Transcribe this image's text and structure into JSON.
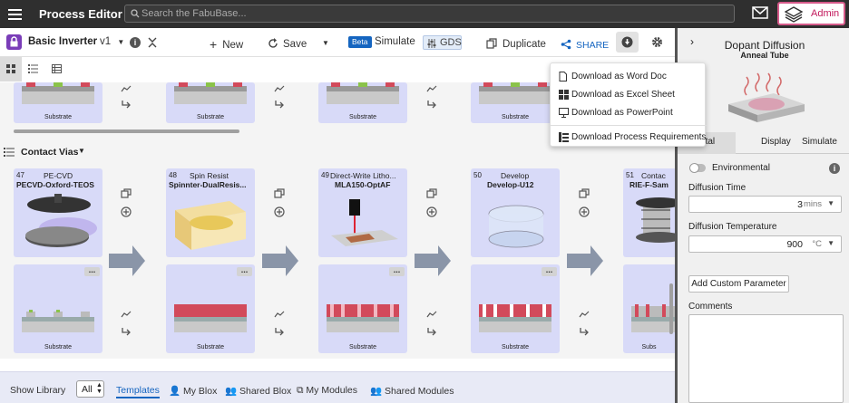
{
  "app": {
    "title": "Process Editor",
    "search_placeholder": "Search the FabuBase...",
    "admin_label": "Admin"
  },
  "toolbar": {
    "process_name": "Basic Inverter",
    "version": "v1",
    "new_label": "New",
    "save_label": "Save",
    "beta_badge": "Beta",
    "simulate_label": "Simulate",
    "gds_label": "GDS",
    "duplicate_label": "Duplicate",
    "share_label": "SHARE"
  },
  "download_menu": {
    "items": [
      "Download as Word Doc",
      "Download as Excel Sheet",
      "Download as PowerPoint",
      "Download Process Requirements"
    ]
  },
  "top_row": {
    "substrate_label": "Substrate"
  },
  "section": {
    "title": "Contact Vias"
  },
  "steps": [
    {
      "num": "47",
      "type": "PE-CVD",
      "name": "PECVD-Oxford-TEOS"
    },
    {
      "num": "48",
      "type": "Spin Resist",
      "name": "Spinnter-DualResis..."
    },
    {
      "num": "49",
      "type": "Direct-Write Litho...",
      "name": "MLA150-OptAF"
    },
    {
      "num": "50",
      "type": "Develop",
      "name": "Develop-U12"
    },
    {
      "num": "51",
      "type": "Contac",
      "name": "RIE-F-Sam"
    }
  ],
  "bottom_row": {
    "substrate_label": "Substrate",
    "partial_label": "Subs"
  },
  "bottombar": {
    "show_library": "Show Library",
    "filter": "All",
    "templates": "Templates",
    "my_blox": "My Blox",
    "shared_blox": "Shared Blox",
    "my_modules": "My Modules",
    "shared_modules": "Shared Modules"
  },
  "panel": {
    "title": "Dopant Diffusion",
    "subtitle": "Anneal Tube",
    "tabs": [
      "erimental",
      "Display",
      "Simulate"
    ],
    "environmental_label": "Environmental",
    "diffusion_time": {
      "label": "Diffusion Time",
      "value": "3",
      "unit": "mins"
    },
    "diffusion_temperature": {
      "label": "Diffusion Temperature",
      "value": "900",
      "unit": "°C"
    },
    "custom_param_label": "Add Custom Parameter",
    "comments_label": "Comments"
  },
  "colors": {
    "topbar": "#2f2f2f",
    "accent": "#1565c0",
    "admin": "#c2185b",
    "card": "#d8daf8",
    "arrow": "#8a95a8"
  }
}
